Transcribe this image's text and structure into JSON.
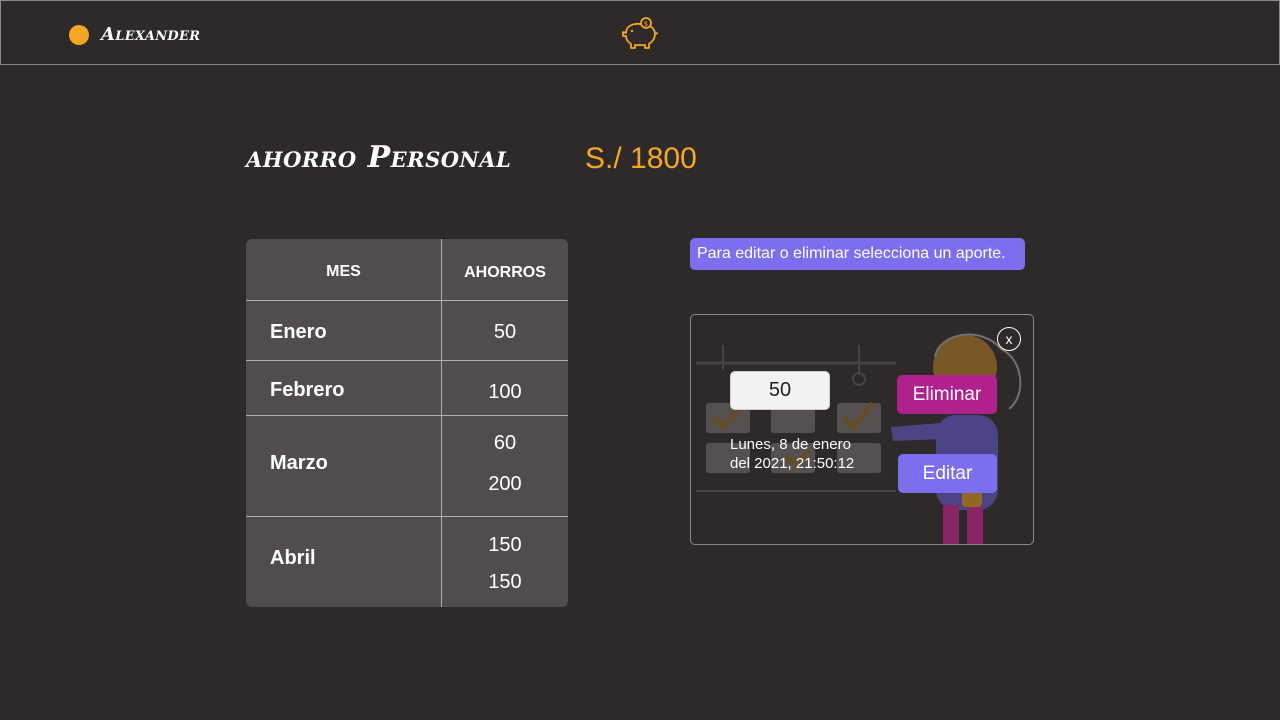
{
  "header": {
    "user_name": "Alexander",
    "logo_icon": "piggy-bank-icon",
    "user_dot_color": "#f5a623"
  },
  "page": {
    "title": "ahorro Personal",
    "total": "S./ 1800"
  },
  "table": {
    "columns": [
      "MES",
      "AHORROS"
    ],
    "rows": [
      {
        "month": "Enero",
        "amounts": [
          "50"
        ]
      },
      {
        "month": "Febrero",
        "amounts": [
          "100"
        ]
      },
      {
        "month": "Marzo",
        "amounts": [
          "60",
          "200"
        ]
      },
      {
        "month": "Abril",
        "amounts": [
          "150",
          "150"
        ]
      }
    ]
  },
  "banner": {
    "text": "Para editar o eliminar selecciona un aporte."
  },
  "panel": {
    "close_label": "x",
    "amount_value": "50",
    "date_line1": "Lunes, 8 de enero",
    "date_line2": "del 2021, 21:50:12",
    "delete_label": "Eliminar",
    "edit_label": "Editar"
  },
  "colors": {
    "background": "#2e2a2a",
    "accent_orange": "#f5a623",
    "accent_purple": "#7b6ff0",
    "accent_magenta": "#b0218e",
    "table_bg": "#524d4d"
  }
}
